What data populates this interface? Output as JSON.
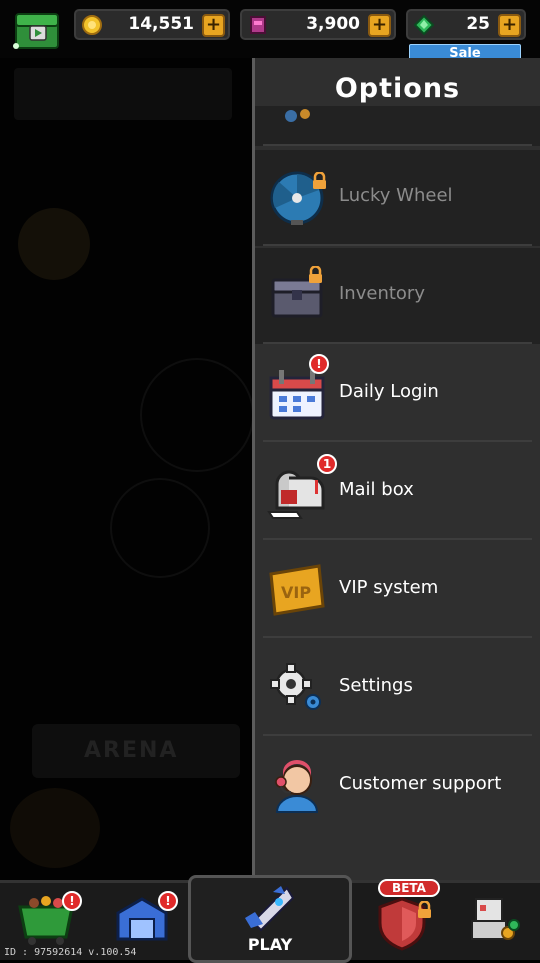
{
  "topbar": {
    "coins": "14,551",
    "gems_red": "3,900",
    "gems_green": "25",
    "plus": "+",
    "sale": "Sale"
  },
  "panel": {
    "title": "Options",
    "items": [
      {
        "label": "Lucky Wheel",
        "locked": true,
        "icon": "lucky-wheel-icon"
      },
      {
        "label": "Inventory",
        "locked": true,
        "icon": "inventory-chest-icon"
      },
      {
        "label": "Daily Login",
        "alert": "!",
        "icon": "calendar-icon"
      },
      {
        "label": "Mail box",
        "alert": "1",
        "icon": "mailbox-icon"
      },
      {
        "label": "VIP system",
        "icon": "vip-card-icon"
      },
      {
        "label": "Settings",
        "icon": "gear-icon"
      },
      {
        "label": "Customer support",
        "icon": "support-agent-icon"
      }
    ]
  },
  "background": {
    "arena": "ARENA"
  },
  "bottomnav": {
    "play": "PLAY",
    "beta": "BETA",
    "alert_1": "!",
    "alert_2": "!",
    "id_version": "ID : 97592614  v.100.54"
  },
  "colors": {
    "accent_gold": "#e8a521",
    "alert_red": "#e02a2a",
    "sale_blue": "#3a8bd6",
    "panel_bg": "#2f2f2f"
  }
}
